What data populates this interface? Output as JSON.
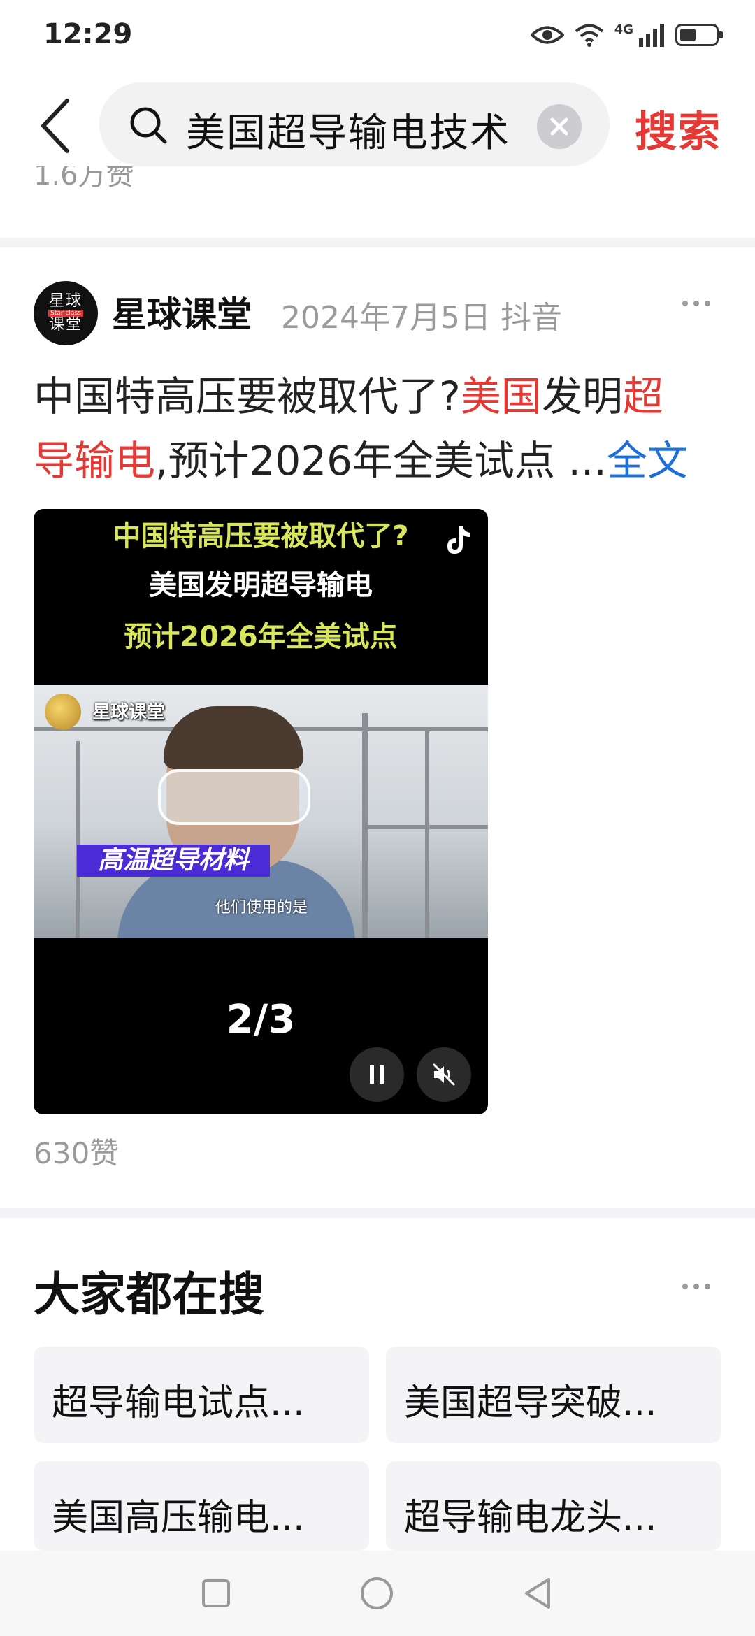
{
  "status_bar": {
    "time": "12:29",
    "network": "4G"
  },
  "search": {
    "query": "美国超导输电技术",
    "submit_label": "搜索"
  },
  "previous_result": {
    "likes": "1.6万赞"
  },
  "post": {
    "author": "星球课堂",
    "avatar_text": {
      "top": "星球",
      "middle": "Star class",
      "bottom": "课堂"
    },
    "date": "2024年7月5日",
    "source": "抖音",
    "text_line1": [
      {
        "text": "中国特高压要被取代了?",
        "highlight": false
      },
      {
        "text": "美国",
        "highlight": true
      },
      {
        "text": "发明",
        "highlight": false
      },
      {
        "text": "超",
        "highlight": true
      }
    ],
    "text_line2": [
      {
        "text": "导输电",
        "highlight": true
      },
      {
        "text": ",预计2026年全美试点 ...",
        "highlight": false
      }
    ],
    "full_text_label": "全文",
    "video": {
      "caption_line1": "中国特高压要被取代了?",
      "caption_line2": "美国发明超导输电",
      "caption_line3": "预计2026年全美试点",
      "channel_watermark": "星球课堂",
      "topic_banner": "高温超导材料",
      "subtitle": "他们使用的是",
      "page_indicator": "2/3"
    },
    "likes": "630赞"
  },
  "trending": {
    "title": "大家都在搜",
    "items": [
      "超导输电试点...",
      "美国超导突破...",
      "美国高压输电...",
      "超导输电龙头..."
    ]
  },
  "colors": {
    "accent_red": "#e53935",
    "link_blue": "#1e6fd9",
    "caption_yellow": "#d7e65a"
  }
}
